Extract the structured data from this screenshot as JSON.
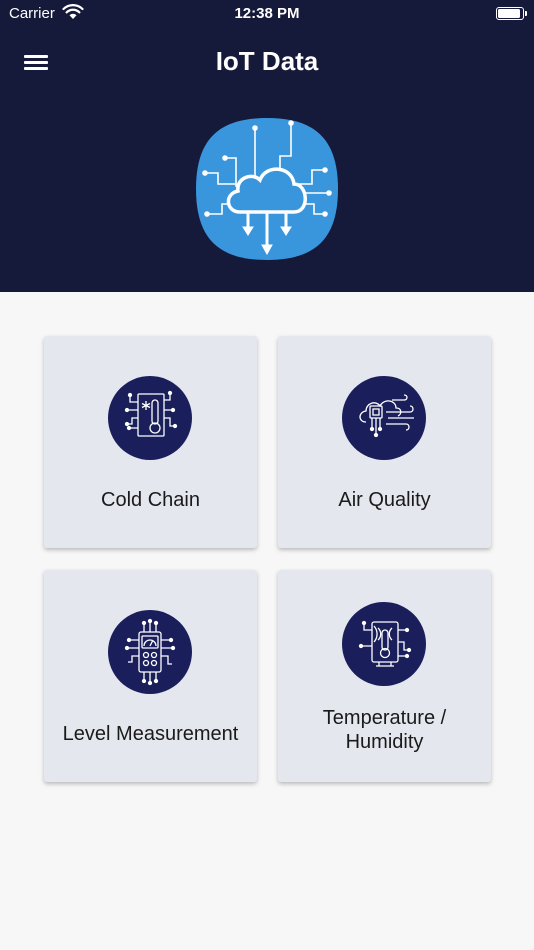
{
  "status_bar": {
    "carrier": "Carrier",
    "time": "12:38 PM"
  },
  "header": {
    "title": "IoT Data",
    "logo_icon": "cloud-circuit-icon",
    "background": "#161a3a",
    "logo_color": "#3a96dc"
  },
  "tiles": [
    {
      "label": "Cold Chain",
      "icon": "cold-chain-icon"
    },
    {
      "label": "Air Quality",
      "icon": "air-quality-icon"
    },
    {
      "label": "Level Measurement",
      "icon": "level-measurement-icon"
    },
    {
      "label_line1": "Temperature /",
      "label_line2": "Humidity",
      "icon": "temperature-humidity-icon"
    }
  ],
  "colors": {
    "tile_background": "#e5e7ef",
    "icon_circle": "#1a1f5c",
    "page_background": "#f7f7f7"
  }
}
